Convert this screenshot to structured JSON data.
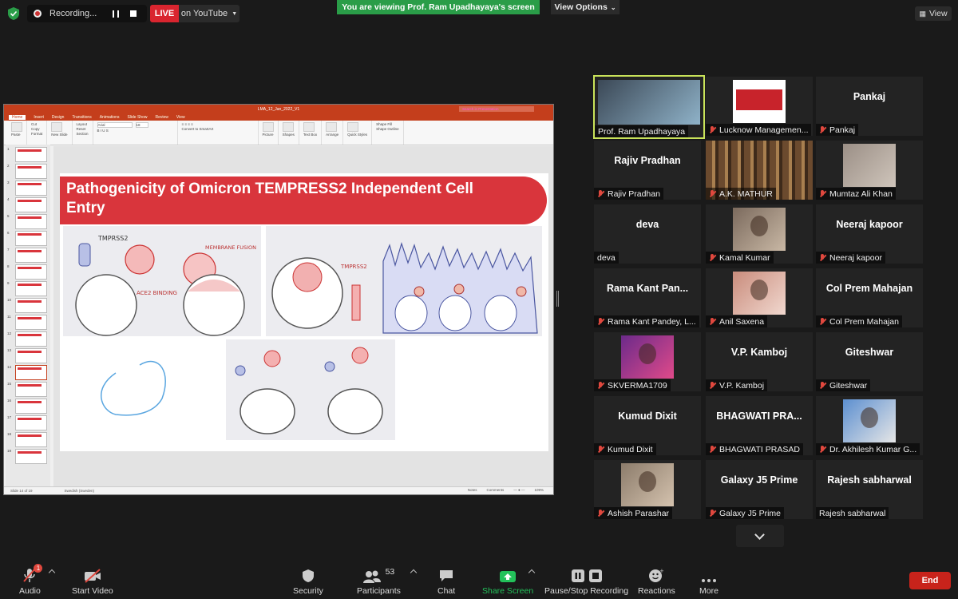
{
  "topbar": {
    "recording_label": "Recording...",
    "live_label": "LIVE",
    "stream_label": "on YouTube",
    "viewing_banner": "You are viewing Prof. Ram  Upadhayaya's screen",
    "view_options": "View Options",
    "view_label": "View"
  },
  "ppt": {
    "filename": "LMA_12_Jan_2022_V1",
    "search_placeholder": "Search in Presentation",
    "tabs": [
      "Home",
      "Insert",
      "Design",
      "Transitions",
      "Animations",
      "Slide Show",
      "Review",
      "View"
    ],
    "ribbon": {
      "paste": "Paste",
      "cut": "Cut",
      "copy": "Copy",
      "format": "Format",
      "new_slide": "New Slide",
      "layout": "Layout",
      "reset": "Reset",
      "section": "Section",
      "font": "Arial",
      "font_size": "18",
      "convert": "Convert to SmartArt",
      "picture": "Picture",
      "shapes": "Shapes",
      "textbox": "Text Box",
      "arrange": "Arrange",
      "quick_styles": "Quick Styles",
      "shape_fill": "Shape Fill",
      "shape_outline": "Shape Outline"
    },
    "thumbnails": [
      "1",
      "2",
      "3",
      "4",
      "5",
      "6",
      "7",
      "8",
      "9",
      "10",
      "11",
      "12",
      "13",
      "14",
      "15",
      "16",
      "17",
      "18",
      "19"
    ],
    "selected_thumb": "14",
    "slide_title": "Pathogenicity of Omicron TEMPRESS2 Independent Cell Entry",
    "drawing_labels": {
      "tmprss2_a": "TMPRSS2",
      "membrane_fusion": "MEMBRANE FUSION",
      "tmprss2_b": "TMPRSS2",
      "ace2": "ACE2 BINDING"
    },
    "status": {
      "slide_count": "Slide 14 of 19",
      "language": "Swedish (Sweden)",
      "notes": "Notes",
      "comments": "Comments",
      "zoom": "109%"
    }
  },
  "participants": [
    {
      "name": "Prof. Ram  Upadhayaya",
      "display": "",
      "photo": "video",
      "active": true
    },
    {
      "name": "Lucknow Managemen...",
      "display": "",
      "photo": "logo"
    },
    {
      "name": "Pankaj",
      "display": "Pankaj"
    },
    {
      "name": "Rajiv Pradhan",
      "display": "Rajiv Pradhan"
    },
    {
      "name": "A.K. MATHUR",
      "display": "",
      "photo": "bookshelf"
    },
    {
      "name": "Mumtaz Ali Khan",
      "display": "",
      "photo": "wall"
    },
    {
      "name": "deva",
      "display": "deva",
      "nomic": true
    },
    {
      "name": "Kamal Kumar",
      "display": "",
      "photo": "person"
    },
    {
      "name": "Neeraj kapoor",
      "display": "Neeraj kapoor"
    },
    {
      "name": "Rama Kant Pandey,  L...",
      "display": "Rama Kant Pan..."
    },
    {
      "name": "Anil Saxena",
      "display": "",
      "photo": "person2"
    },
    {
      "name": "Col Prem Mahajan",
      "display": "Col Prem Mahajan"
    },
    {
      "name": "SKVERMA1709",
      "display": "",
      "photo": "person3"
    },
    {
      "name": "V.P. Kamboj",
      "display": "V.P. Kamboj"
    },
    {
      "name": "Giteshwar",
      "display": "Giteshwar"
    },
    {
      "name": "Kumud Dixit",
      "display": "Kumud Dixit"
    },
    {
      "name": "BHAGWATI PRASAD",
      "display": "BHAGWATI PRA..."
    },
    {
      "name": "Dr. Akhilesh Kumar G...",
      "display": "",
      "photo": "person4"
    },
    {
      "name": "Ashish Parashar",
      "display": "",
      "photo": "person5"
    },
    {
      "name": "Galaxy J5 Prime",
      "display": "Galaxy J5 Prime"
    },
    {
      "name": "Rajesh sabharwal",
      "display": "Rajesh sabharwal",
      "nomic": true
    }
  ],
  "toolbar": {
    "audio": "Audio",
    "audio_badge": "1",
    "start_video": "Start Video",
    "security": "Security",
    "participants": "Participants",
    "participants_count": "53",
    "chat": "Chat",
    "share_screen": "Share Screen",
    "pause_stop": "Pause/Stop Recording",
    "reactions": "Reactions",
    "more": "More",
    "end": "End"
  },
  "colors": {
    "accent_green": "#2a9d48",
    "live_red": "#d9252f",
    "end_red": "#c8231b",
    "slide_header_red": "#d9353c",
    "active_speaker": "#c9e35a"
  }
}
